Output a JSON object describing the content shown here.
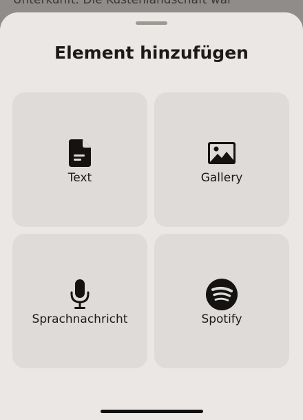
{
  "background": {
    "text": "Unterkunft. Die Küstenlandschaft war"
  },
  "sheet": {
    "title": "Element hinzufügen",
    "options": [
      {
        "label": "Text",
        "icon": "document-icon"
      },
      {
        "label": "Gallery",
        "icon": "image-icon"
      },
      {
        "label": "Sprachnachricht",
        "icon": "microphone-icon"
      },
      {
        "label": "Spotify",
        "icon": "spotify-icon"
      }
    ]
  },
  "colors": {
    "sheet_background": "#ebe7e4",
    "tile_background": "#dfdbd8",
    "text": "#1c1a19"
  }
}
